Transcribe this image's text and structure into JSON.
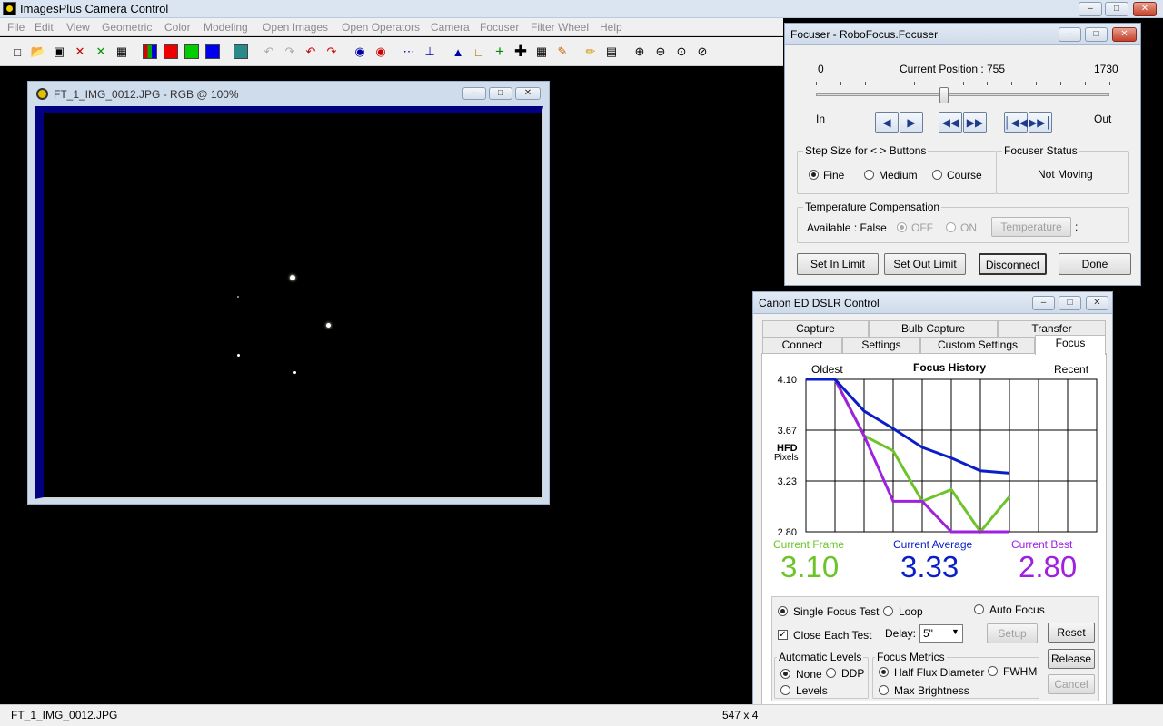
{
  "app": {
    "title": "ImagesPlus Camera Control"
  },
  "menu": [
    "File",
    "Edit",
    "View",
    "Geometric",
    "Color",
    "Modeling",
    "Open Images",
    "Open Operators",
    "Camera",
    "Focuser",
    "Filter Wheel",
    "Help"
  ],
  "image_window": {
    "title": "FT_1_IMG_0012.JPG - RGB @ 100%"
  },
  "status": {
    "file": "FT_1_IMG_0012.JPG",
    "size": "547 x 4"
  },
  "focuser": {
    "title": "Focuser - RoboFocus.Focuser",
    "min": "0",
    "max": "1730",
    "position_label": "Current Position :",
    "position_value": "755",
    "position_fraction": 0.436,
    "in_label": "In",
    "out_label": "Out",
    "step_group": "Step Size for < > Buttons",
    "step_options": [
      "Fine",
      "Medium",
      "Course"
    ],
    "status_group": "Focuser Status",
    "status_value": "Not Moving",
    "temp_group": "Temperature Compensation",
    "temp_available": "Available : False",
    "temp_off": "OFF",
    "temp_on": "ON",
    "temp_button": "Temperature",
    "temp_colon": ":",
    "buttons": {
      "set_in": "Set In Limit",
      "set_out": "Set Out Limit",
      "disconnect": "Disconnect",
      "done": "Done"
    }
  },
  "dslr": {
    "title": "Canon ED DSLR Control",
    "tabs_row1": [
      "Capture",
      "Bulb Capture",
      "Transfer"
    ],
    "tabs_row2": [
      "Connect",
      "Settings",
      "Custom Settings",
      "Focus"
    ],
    "chart_labels": {
      "oldest": "Oldest",
      "title": "Focus History",
      "recent": "Recent",
      "hfd": "HFD",
      "pixels": "Pixels"
    },
    "metrics": {
      "current_frame_label": "Current Frame",
      "current_frame_value": "3.10",
      "current_avg_label": "Current Average",
      "current_avg_value": "3.33",
      "current_best_label": "Current Best",
      "current_best_value": "2.80"
    },
    "colors": {
      "frame": "#6cc428",
      "average": "#0a1ec8",
      "best": "#a020e0"
    },
    "controls": {
      "single": "Single Focus Test",
      "loop": "Loop",
      "auto": "Auto Focus",
      "close_each": "Close Each Test",
      "delay_label": "Delay:",
      "delay_value": "5\"",
      "setup": "Setup",
      "reset": "Reset",
      "release": "Release",
      "cancel": "Cancel",
      "levels_group": "Automatic Levels",
      "levels_none": "None",
      "levels_ddp": "DDP",
      "levels_levels": "Levels",
      "metrics_group": "Focus Metrics",
      "metric_hfd": "Half Flux Diameter",
      "metric_fwhm": "FWHM",
      "metric_max": "Max Brightness"
    }
  },
  "chart_data": {
    "type": "line",
    "title": "Focus History",
    "ylabel": "HFD Pixels",
    "yticks": [
      "4.10",
      "3.67",
      "3.23",
      "2.80"
    ],
    "ylim": [
      2.8,
      4.1
    ],
    "x": [
      1,
      2,
      3,
      4,
      5,
      6,
      7,
      8,
      9,
      10
    ],
    "series": [
      {
        "name": "Current Average",
        "values": [
          4.1,
          4.1,
          3.83,
          3.68,
          3.52,
          3.43,
          3.32,
          3.3,
          null,
          null
        ]
      },
      {
        "name": "Current Frame",
        "values": [
          4.1,
          4.1,
          3.62,
          3.49,
          3.06,
          3.16,
          2.8,
          3.1,
          null,
          null
        ]
      },
      {
        "name": "Current Best",
        "values": [
          4.1,
          4.1,
          3.62,
          3.06,
          3.06,
          2.8,
          2.8,
          2.8,
          null,
          null
        ]
      }
    ]
  }
}
